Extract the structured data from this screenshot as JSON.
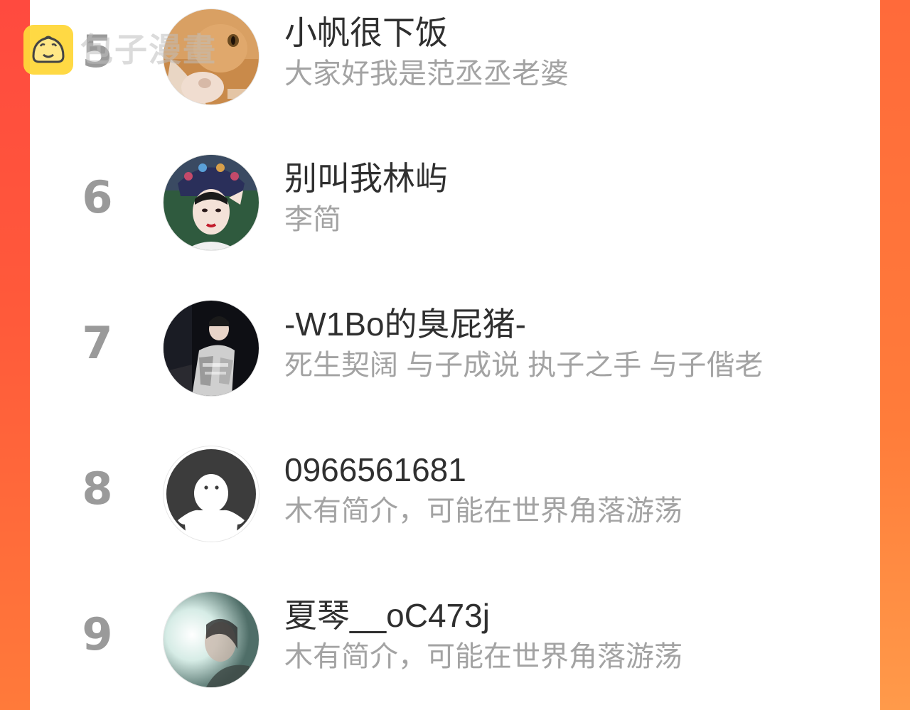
{
  "watermark": {
    "logo_icon": "bun-logo-icon",
    "text": "包子漫畫"
  },
  "ranking": [
    {
      "rank": "5",
      "name": "小帆很下饭",
      "bio": "大家好我是范丞丞老婆",
      "avatar": "orange-cat-avatar"
    },
    {
      "rank": "6",
      "name": "别叫我林屿",
      "bio": "李简",
      "avatar": "qing-costume-woman-avatar"
    },
    {
      "rank": "7",
      "name": "-W1Bo的臭屁猪-",
      "bio": "死生契阔 与子成说 执子之手 与子偕老",
      "avatar": "stage-performer-avatar"
    },
    {
      "rank": "8",
      "name": "0966561681",
      "bio": "木有简介，可能在世界角落游荡",
      "avatar": "default-ghost-avatar"
    },
    {
      "rank": "9",
      "name": "夏琴__oC473j",
      "bio": "木有简介，可能在世界角落游荡",
      "avatar": "soft-light-portrait-avatar"
    }
  ]
}
